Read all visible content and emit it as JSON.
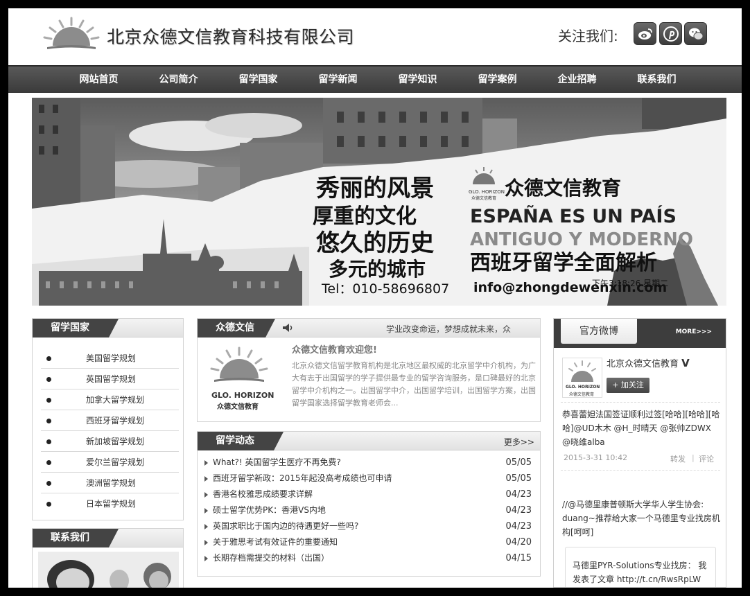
{
  "header": {
    "company_name": "北京众德文信教育科技有限公司",
    "follow_label": "关注我们:",
    "social_icons": [
      "weibo-icon",
      "pinterest-icon",
      "wechat-icon"
    ]
  },
  "nav": {
    "items": [
      "网站首页",
      "公司简介",
      "留学国家",
      "留学新闻",
      "留学知识",
      "留学案例",
      "企业招聘",
      "联系我们"
    ]
  },
  "banner": {
    "lines_left": [
      "秀丽的风景",
      "厚重的文化",
      "悠久的历史",
      "多元的城市"
    ],
    "tel": "Tel：010-58696807",
    "logo_text": "GLO. HORIZON",
    "logo_sub": "众德文信教育",
    "brand": "众德文信教育",
    "spain_line1": "ESPAÑA ES UN PAÍS",
    "spain_line2": "ANTIGUO Y MODERNO",
    "headline": "西班牙留学全面解析",
    "email": "info@zhongdewenxin.com",
    "clock": "下午3:18:26 星期二"
  },
  "countries": {
    "title": "留学国家",
    "items": [
      "美国留学规划",
      "英国留学规划",
      "加拿大留学规划",
      "西班牙留学规划",
      "新加坡留学规划",
      "爱尔兰留学规划",
      "澳洲留学规划",
      "日本留学规划"
    ]
  },
  "contact": {
    "title": "联系我们"
  },
  "intro": {
    "title": "众德文信",
    "marquee": "学业改变命运，梦想成就未来，众",
    "logo_text": "GLO. HORIZON",
    "logo_sub": "众德文信教育",
    "welcome": "众德文信教育欢迎您!",
    "body": "北京众德文信留学教育机构是北京地区最权威的北京留学中介机构，为广大有志于出国留学的学子提供最专业的留学咨询服务，是口碑最好的北京留学中介机构之一。出国留学中介，出国留学培训，出国留学方案，出国留学国家选择留学教育老师会..."
  },
  "news": {
    "title": "留学动态",
    "more": "更多>>",
    "items": [
      {
        "title": "What?! 英国留学生医疗不再免费?",
        "date": "05/05"
      },
      {
        "title": "西班牙留学新政：2015年起没高考成绩也可申请",
        "date": "05/05"
      },
      {
        "title": "香港名校雅思成绩要求详解",
        "date": "04/23"
      },
      {
        "title": "硕士留学优势PK：香港VS内地",
        "date": "04/23"
      },
      {
        "title": "英国求职比于国内边的待遇更好一些吗?",
        "date": "04/23"
      },
      {
        "title": "关于雅思考试有效证件的重要通知",
        "date": "04/20"
      },
      {
        "title": "长期存档需提交的材料（出国）",
        "date": "04/15"
      }
    ]
  },
  "weibo": {
    "tab": "官方微博",
    "more": "MORE>>>",
    "account_name": "北京众德文信教育",
    "verified": "V",
    "follow_button": "+ 加关注",
    "logo_text": "GLO. HORIZON",
    "logo_sub": "众德文信教育",
    "post1_text": "恭喜蕾妲法国签证顺利过签[哈哈][哈哈][哈哈]@UD木木 @H_时晴天 @张帅ZDWX @晓维alba",
    "post1_time": "2015-3-31 10:42",
    "repost": "转发",
    "sep": "|",
    "comment": "评论",
    "post2_text": "//@马德里康普顿斯大学华人学生协会: duang~推荐给大家一个马德里专业找房机构[呵呵]",
    "quote_text": "马德里PYR-Solutions专业找房： 我发表了文章 http://t.cn/RwsRpLW"
  },
  "colors": {
    "nav_bg": "#474747",
    "tab_bg": "#444444",
    "page_bg": "#ffffff",
    "frame": "#000000"
  }
}
